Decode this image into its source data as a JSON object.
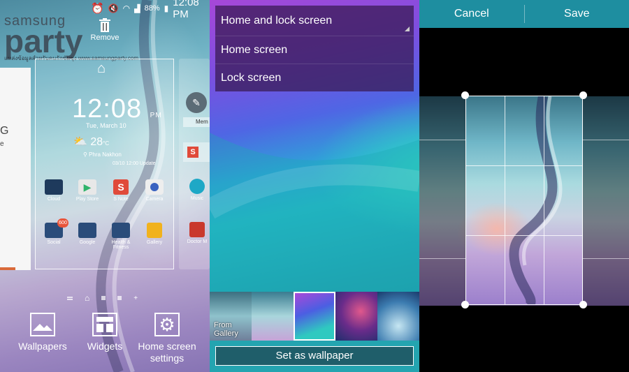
{
  "statusbar": {
    "battery": "88%",
    "time": "12:08 PM"
  },
  "watermark": {
    "line1": "samsung",
    "line2": "party",
    "line3": "แหล่งข้อมูลสำหรับคนรักซัมซุง  www.samsungparty.com"
  },
  "edit_screen": {
    "remove_label": "Remove",
    "left_card": {
      "text1": "G",
      "text2": "e"
    },
    "page_card": {
      "clock": "12:08",
      "clock_suffix": "PM",
      "date": "Tue, March 10",
      "temperature": "28",
      "location": "Phra Nakhon",
      "updated": "03/10 12:00 Update"
    },
    "apps": [
      {
        "label": "Cloud"
      },
      {
        "label": "Play Store"
      },
      {
        "label": "S Note"
      },
      {
        "label": "Camera"
      },
      {
        "label": "Social",
        "badge": "600"
      },
      {
        "label": "Google"
      },
      {
        "label": "Health & Fitness"
      },
      {
        "label": "Gallery"
      }
    ],
    "right_card": {
      "tab_label": "Mem",
      "apps": [
        {
          "label": "Music"
        },
        {
          "label": "Doctor M"
        }
      ]
    },
    "bottom_buttons": [
      {
        "label": "Wallpapers"
      },
      {
        "label": "Widgets"
      },
      {
        "label_line1": "Home screen",
        "label_line2": "settings"
      }
    ]
  },
  "wallpaper_picker": {
    "options": [
      "Home and lock screen",
      "Home screen",
      "Lock screen"
    ],
    "gallery_line1": "From",
    "gallery_line2": "Gallery",
    "set_button": "Set as wallpaper"
  },
  "crop_screen": {
    "cancel": "Cancel",
    "save": "Save"
  },
  "colors": {
    "crop_actionbar": "#1e8ea0",
    "set_bar": "#24a4b0",
    "set_button": "#1f5e6a"
  }
}
